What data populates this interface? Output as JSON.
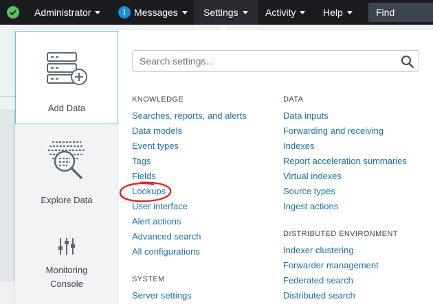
{
  "topbar": {
    "status_icon": "check-circle-icon",
    "user_menu": "Administrator",
    "messages": {
      "count": "1",
      "label": "Messages"
    },
    "settings": "Settings",
    "activity": "Activity",
    "help": "Help",
    "find_placeholder": "Find"
  },
  "left_rail": {
    "tiles": [
      {
        "label": "Add Data",
        "icon": "add-data-icon"
      },
      {
        "label": "Explore Data",
        "icon": "explore-data-icon"
      },
      {
        "label_lines": [
          "Monitoring",
          "Console"
        ],
        "icon": "monitoring-console-icon"
      }
    ]
  },
  "search": {
    "placeholder": "Search settings..."
  },
  "knowledge": {
    "title": "KNOWLEDGE",
    "items": [
      "Searches, reports, and alerts",
      "Data models",
      "Event types",
      "Tags",
      "Fields",
      "Lookups",
      "User interface",
      "Alert actions",
      "Advanced search",
      "All configurations"
    ]
  },
  "system": {
    "title": "SYSTEM",
    "items": [
      "Server settings"
    ]
  },
  "data": {
    "title": "DATA",
    "items": [
      "Data inputs",
      "Forwarding and receiving",
      "Indexes",
      "Report acceleration summaries",
      "Virtual indexes",
      "Source types",
      "Ingest actions"
    ]
  },
  "distributed": {
    "title": "DISTRIBUTED ENVIRONMENT",
    "items": [
      "Indexer clustering",
      "Forwarder management",
      "Federated search",
      "Distributed search"
    ]
  },
  "annotation": {
    "circled_item": "Lookups",
    "color": "#e3242b"
  },
  "colors": {
    "link": "#1a6fab",
    "topbar": "#1a1c20",
    "selected_border": "#58c5e8",
    "status": "#5cc05c",
    "badge": "#1a8cd8"
  }
}
